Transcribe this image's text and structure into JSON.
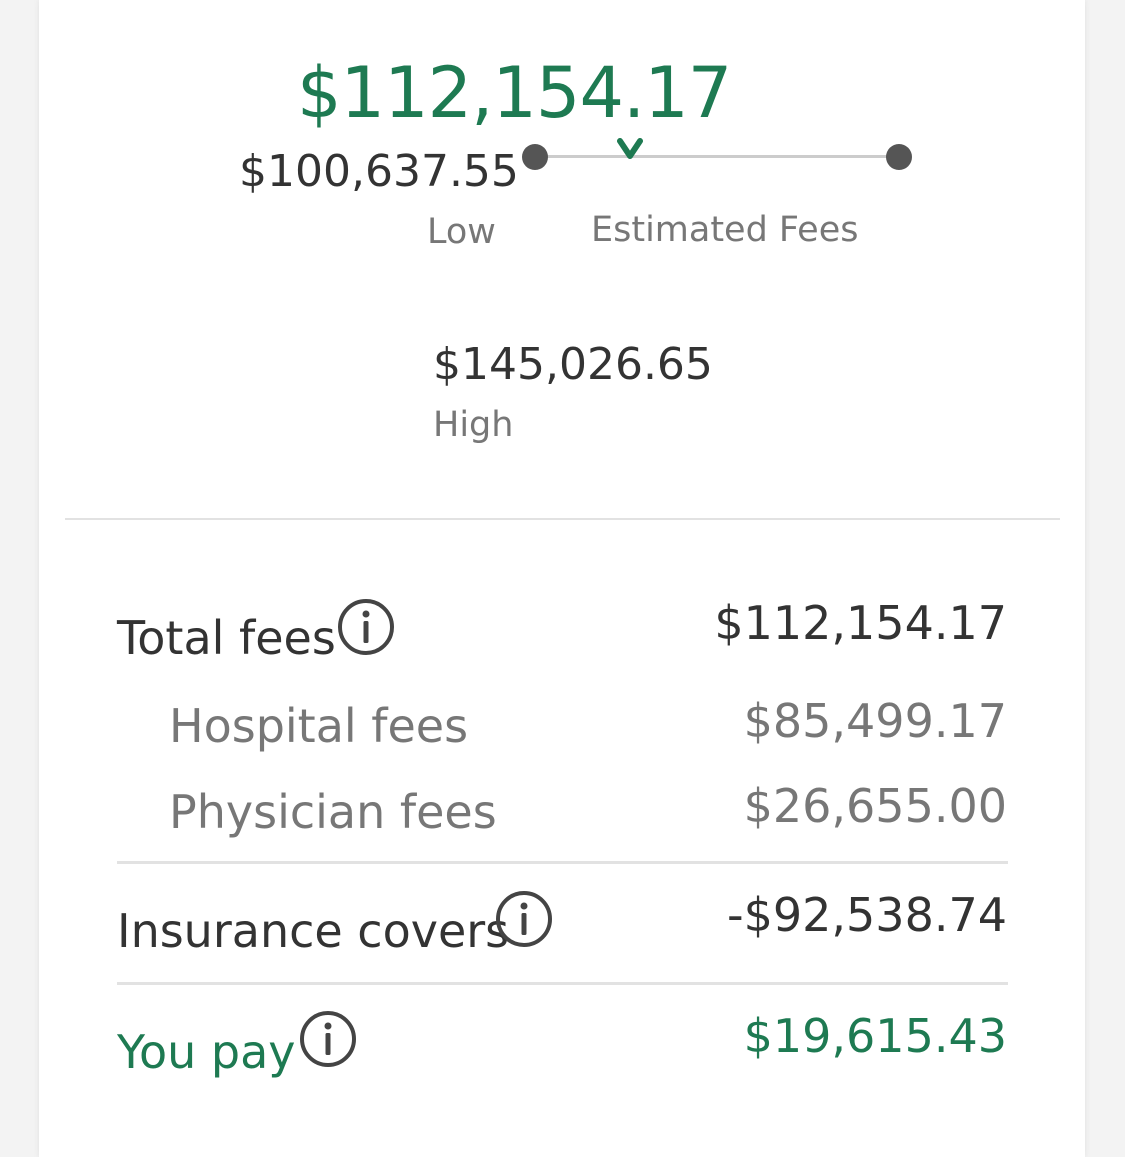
{
  "estimate": {
    "estimated_value": "$112,154.17",
    "estimated_label": "Estimated Fees",
    "low_value": "$100,637.55",
    "low_label": "Low",
    "high_value": "$145,026.65",
    "high_label": "High",
    "marker_position_fraction": 0.26
  },
  "breakdown": {
    "total_fees": {
      "label": "Total fees",
      "value": "$112,154.17"
    },
    "hospital_fees": {
      "label": "Hospital fees",
      "value": "$85,499.17"
    },
    "physician_fees": {
      "label": "Physician fees",
      "value": "$26,655.00"
    },
    "insurance_covers": {
      "label": "Insurance covers",
      "value": "-$92,538.74"
    },
    "you_pay": {
      "label": "You pay",
      "value": "$19,615.43"
    }
  },
  "icons": {
    "info": "info-circle-icon",
    "marker": "chevron-down-marker-icon"
  },
  "colors": {
    "accent_green": "#1e7a52",
    "primary_text": "#333333",
    "secondary_text": "#777777",
    "divider": "#e2e2e2"
  }
}
